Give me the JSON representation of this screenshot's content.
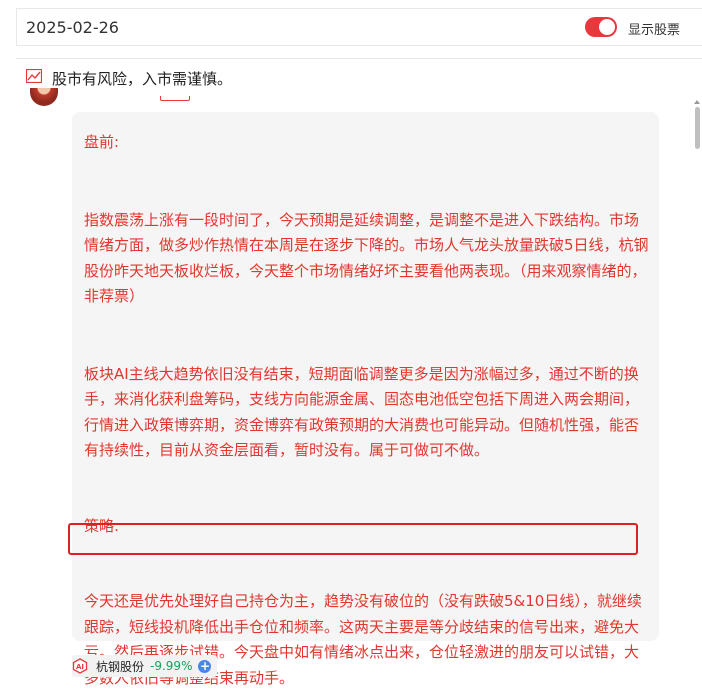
{
  "header": {
    "date": "2025-02-26",
    "toggle_label": "显示股票",
    "toggle_on": true,
    "accent_color": "#e8383d"
  },
  "notice": {
    "icon": "chart-icon",
    "text": "股市有风险，入市需谨慎。"
  },
  "post": {
    "text_color": "#e2362f",
    "paragraphs": [
      "盘前:",
      "指数震荡上涨有一段时间了，今天预期是延续调整，是调整不是进入下跌结构。市场情绪方面，做多炒作热情在本周是在逐步下降的。市场人气龙头放量跌破5日线，杭钢股份昨天地天板收烂板，今天整个市场情绪好坏主要看他两表现。（用来观察情绪的，非荐票）",
      "板块AI主线大趋势依旧没有结束，短期面临调整更多是因为涨幅过多，通过不断的换手，来消化获利盘筹码，支线方向能源金属、固态电池低空包括下周进入两会期间，行情进入政策博弈期，资金博弈有政策预期的大消费也可能异动。但随机性强，能否有持续性，目前从资金层面看，暂时没有。属于可做可不做。",
      "策略:",
      "今天还是优先处理好自己持仓为主，趋势没有破位的（没有跌破5&10日线），就继续跟踪，短线投机降低出手仓位和频率。这两天主要是等分歧结束的信号出来，避免大亏。然后再逐步试错。今天盘中如有情绪冰点出来，仓位轻激进的朋友可以试错，大多数人依旧等调整结束再动手。"
    ]
  },
  "stock_tag": {
    "icon": "ai-icon",
    "name": "杭钢股份",
    "change": "-9.99%",
    "change_color": "#17a05d",
    "add_icon": "plus-circle-icon"
  }
}
